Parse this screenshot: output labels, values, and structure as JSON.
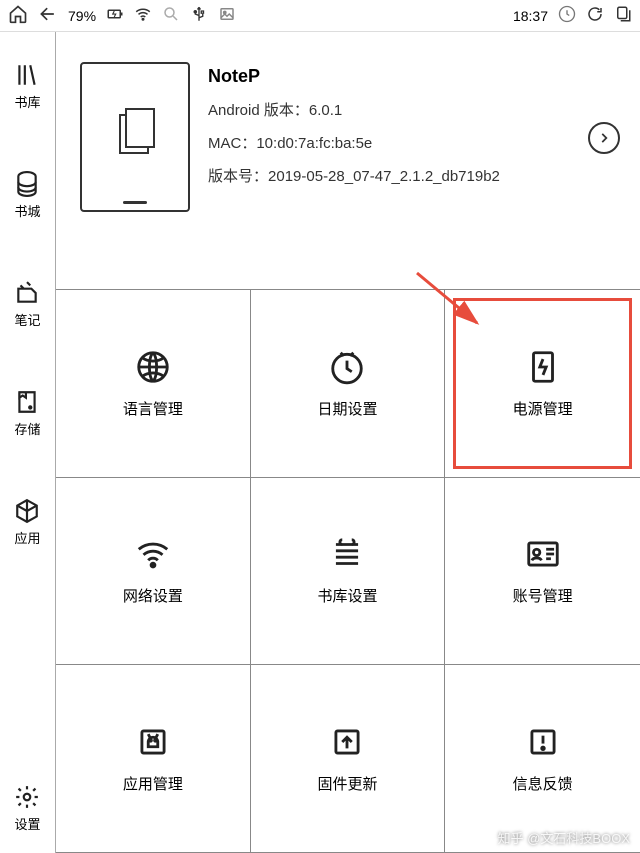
{
  "status": {
    "battery": "79%",
    "time": "18:37"
  },
  "sidebar": {
    "items": [
      {
        "label": "书库"
      },
      {
        "label": "书城"
      },
      {
        "label": "笔记"
      },
      {
        "label": "存储"
      },
      {
        "label": "应用"
      },
      {
        "label": "设置"
      }
    ]
  },
  "device": {
    "name": "NoteP",
    "android_label": "Android 版本：",
    "android_value": "6.0.1",
    "mac_label": "MAC：",
    "mac_value": "10:d0:7a:fc:ba:5e",
    "build_label": "版本号：",
    "build_value": "2019-05-28_07-47_2.1.2_db719b2"
  },
  "grid": {
    "items": [
      {
        "label": "语言管理"
      },
      {
        "label": "日期设置"
      },
      {
        "label": "电源管理"
      },
      {
        "label": "网络设置"
      },
      {
        "label": "书库设置"
      },
      {
        "label": "账号管理"
      },
      {
        "label": "应用管理"
      },
      {
        "label": "固件更新"
      },
      {
        "label": "信息反馈"
      }
    ]
  },
  "watermark": "知乎 @文石科技BOOX"
}
